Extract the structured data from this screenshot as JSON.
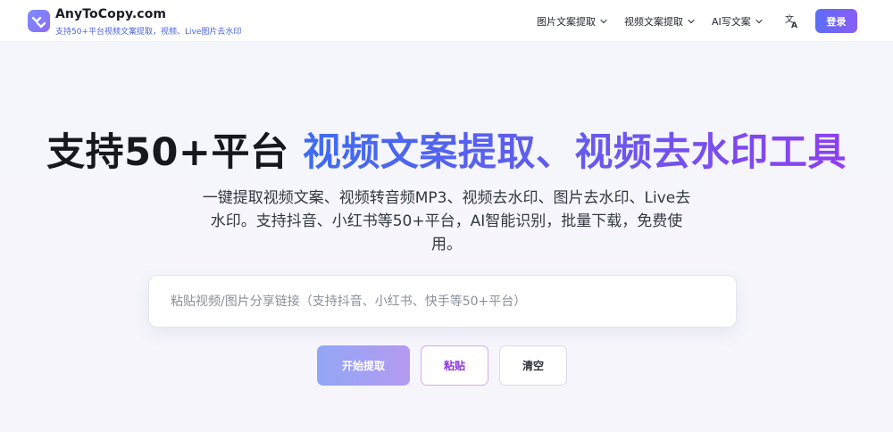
{
  "header": {
    "brand_name": "AnyToCopy.com",
    "brand_subtitle": "支持50+平台视频文案提取，视频、Live图片去水印",
    "nav": [
      {
        "label": "图片文案提取",
        "icon": "chevron-down-icon"
      },
      {
        "label": "视频文案提取",
        "icon": "chevron-down-icon"
      },
      {
        "label": "AI写文案",
        "icon": "chevron-down-icon"
      }
    ],
    "translate_icon": "translate-icon",
    "login_label": "登录"
  },
  "hero": {
    "title_plain": "支持50+平台 ",
    "title_highlight": "视频文案提取、视频去水印工具",
    "description": "一键提取视频文案、视频转音频MP3、视频去水印、图片去水印、Live去水印。支持抖音、小红书等50+平台，AI智能识别，批量下载，免费使用。"
  },
  "search": {
    "placeholder": "粘贴视频/图片分享链接（支持抖音、小红书、快手等50+平台）",
    "value": ""
  },
  "actions": {
    "start_label": "开始提取",
    "paste_label": "粘贴",
    "clear_label": "清空"
  },
  "colors": {
    "accent_start": "#5b6ef7",
    "accent_end": "#8a5cf5",
    "paste_text": "#8a36e0",
    "brand_subtitle": "#4a64d8"
  }
}
